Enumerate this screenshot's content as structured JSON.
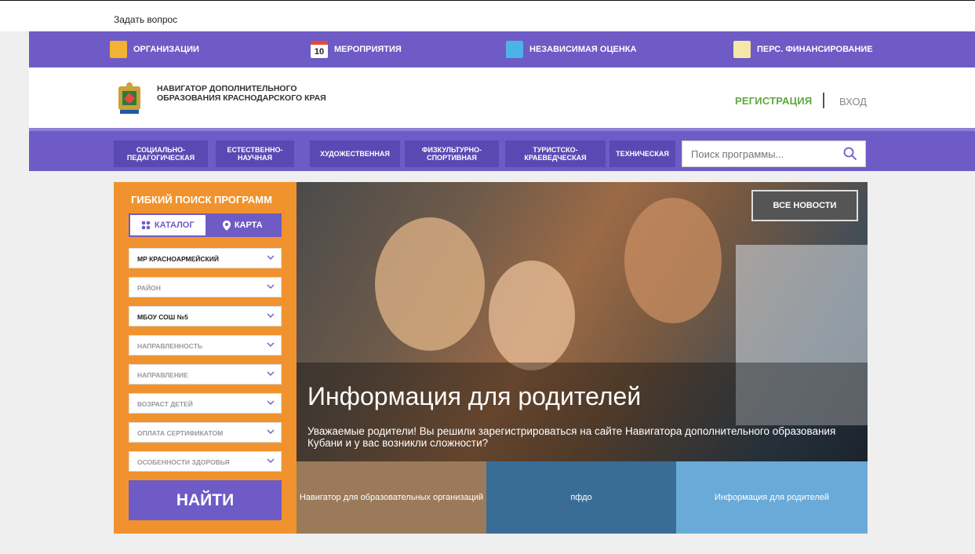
{
  "ask": "Задать вопрос",
  "topnav": {
    "orgs": "ОРГАНИЗАЦИИ",
    "events": "МЕРОПРИЯТИЯ",
    "events_day": "10",
    "assessment": "НЕЗАВИСИМАЯ ОЦЕНКА",
    "financing": "ПЕРС. ФИНАНСИРОВАНИЕ"
  },
  "header": {
    "brand": "НАВИГАТОР ДОПОЛНИТЕЛЬНОГО ОБРАЗОВАНИЯ КРАСНОДАРСКОГО КРАЯ",
    "register": "РЕГИСТРАЦИЯ",
    "login": "ВХОД"
  },
  "categories": [
    "СОЦИАЛЬНО-ПЕДАГОГИЧЕСКАЯ",
    "ЕСТЕСТВЕННО-НАУЧНАЯ",
    "ХУДОЖЕСТВЕННАЯ",
    "ФИЗКУЛЬТУРНО-СПОРТИВНАЯ",
    "ТУРИСТСКО-КРАЕВЕДЧЕСКАЯ",
    "ТЕХНИЧЕСКАЯ"
  ],
  "search": {
    "placeholder": "Поиск программы..."
  },
  "filter": {
    "title": "ГИБКИЙ ПОИСК ПРОГРАММ",
    "tab_catalog": "КАТАЛОГ",
    "tab_map": "КАРТА",
    "selects": [
      "МР КРАСНОАРМЕЙСКИЙ",
      "РАЙОН",
      "МБОУ СОШ №5",
      "НАПРАВЛЕННОСТЬ",
      "НАПРАВЛЕНИЕ",
      "ВОЗРАСТ ДЕТЕЙ",
      "ОПЛАТА СЕРТИФИКАТОМ",
      "ОСОБЕННОСТИ ЗДОРОВЬЯ"
    ],
    "find": "НАЙТИ"
  },
  "hero": {
    "all_news": "ВСЕ НОВОСТИ",
    "title": "Информация для родителей",
    "text": "Уважаемые родители! Вы решили зарегистрироваться на сайте Навигатора дополнительного образования Кубани и у вас возникли сложности?"
  },
  "thumbs": [
    "Навигатор для образовательных организаций",
    "пфдо",
    "Информация для родителей"
  ],
  "colors": {
    "purple": "#6e5bc5",
    "orange": "#f0932f",
    "green": "#5daa3a"
  }
}
